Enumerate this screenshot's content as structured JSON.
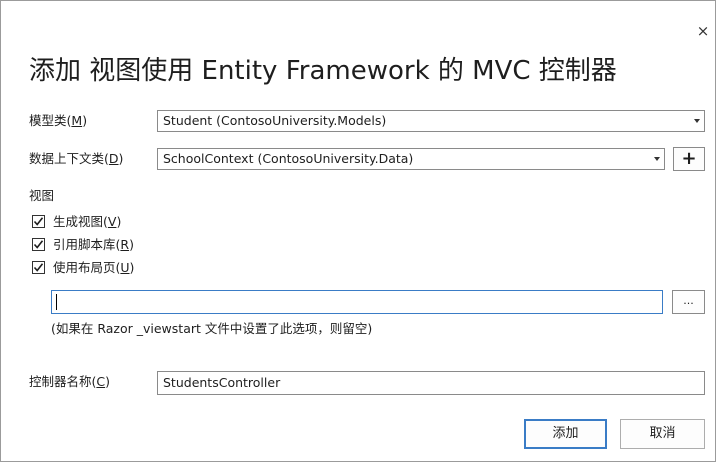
{
  "dialog": {
    "title": "添加 视图使用 Entity Framework 的 MVC 控制器",
    "close_glyph": "×"
  },
  "model_class": {
    "label": "模型类(",
    "accel": "M",
    "label_end": ")",
    "value": "Student (ContosoUniversity.Models)"
  },
  "data_context": {
    "label": "数据上下文类(",
    "accel": "D",
    "label_end": ")",
    "value": "SchoolContext (ContosoUniversity.Data)",
    "add_glyph": "+"
  },
  "views": {
    "heading": "视图",
    "options": [
      {
        "label": "生成视图(",
        "accel": "V",
        "label_end": ")",
        "checked": true
      },
      {
        "label": "引用脚本库(",
        "accel": "R",
        "label_end": ")",
        "checked": true
      },
      {
        "label": "使用布局页(",
        "accel": "U",
        "label_end": ")",
        "checked": true
      }
    ],
    "layout_path_value": "",
    "browse_label": "...",
    "hint": "(如果在 Razor _viewstart 文件中设置了此选项，则留空)"
  },
  "controller": {
    "label": "控制器名称(",
    "accel": "C",
    "label_end": ")",
    "value": "StudentsController"
  },
  "buttons": {
    "add": "添加",
    "cancel": "取消"
  },
  "colors": {
    "focus_border": "#3a7cc6",
    "border": "#8a8a8a"
  }
}
